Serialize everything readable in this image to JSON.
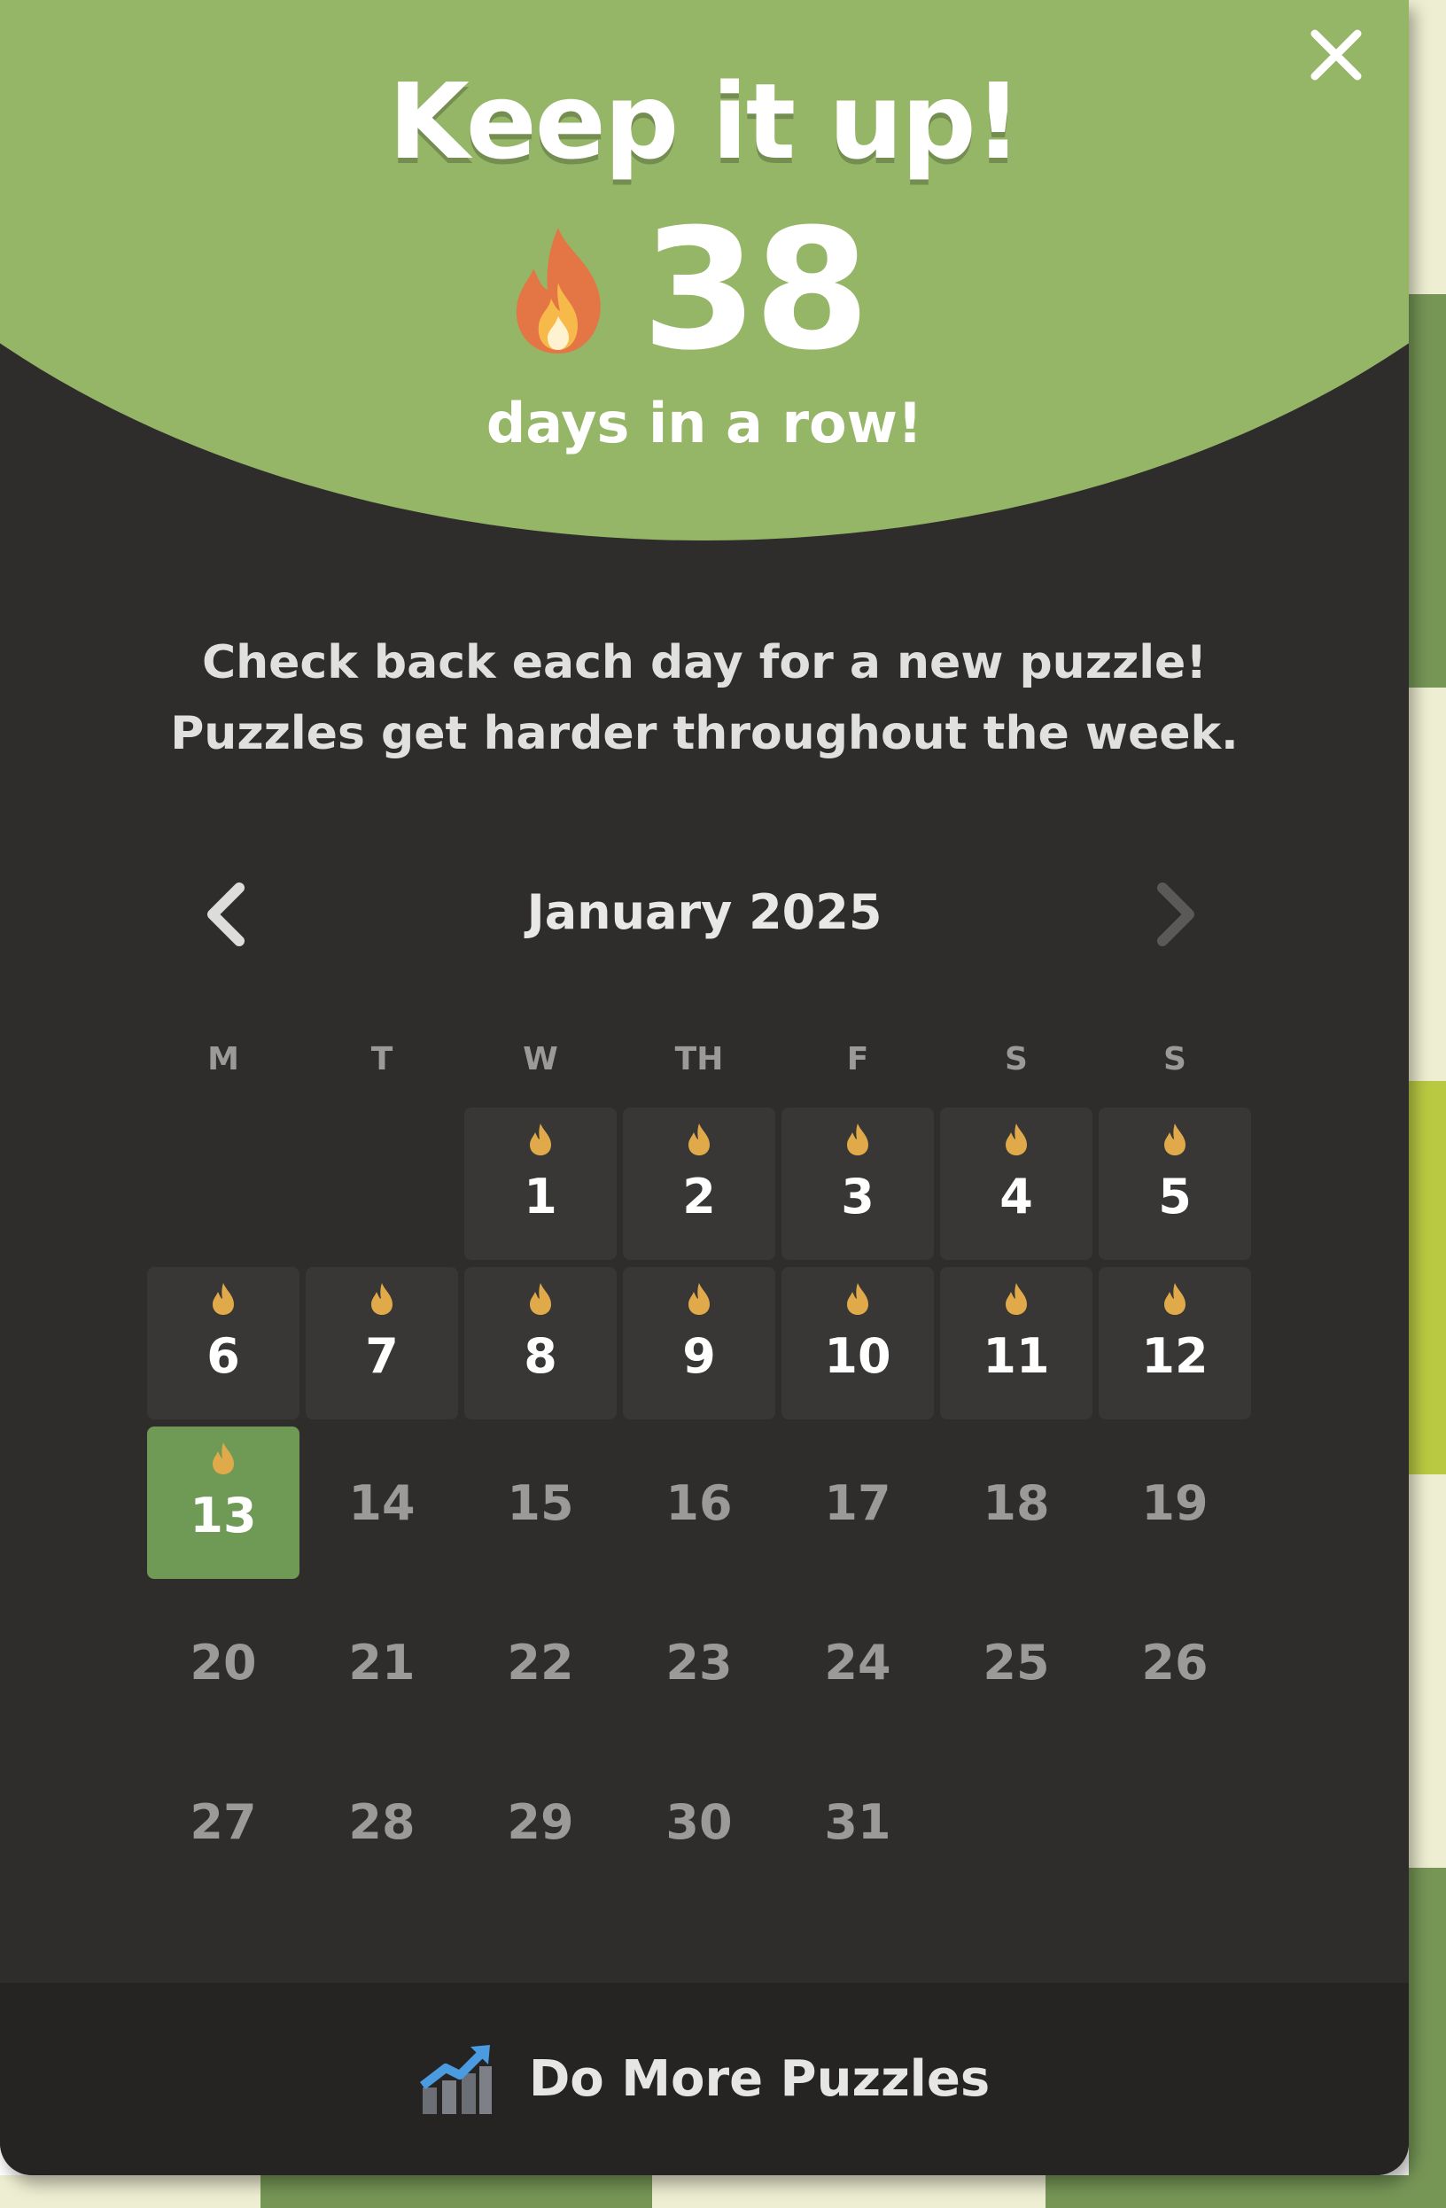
{
  "modal": {
    "title": "Keep it up!",
    "streak_count": "38",
    "streak_label": "days in a row!",
    "subtitle_line1": "Check back each day for a new puzzle!",
    "subtitle_line2": "Puzzles get harder throughout the week.",
    "close_icon": "close-icon"
  },
  "calendar": {
    "month_label": "January 2025",
    "prev_icon": "chevron-left-icon",
    "next_icon": "chevron-right-icon",
    "weekdays": [
      "M",
      "T",
      "W",
      "TH",
      "F",
      "S",
      "S"
    ],
    "days": [
      {
        "day": "1",
        "status": "completed"
      },
      {
        "day": "2",
        "status": "completed"
      },
      {
        "day": "3",
        "status": "completed"
      },
      {
        "day": "4",
        "status": "completed"
      },
      {
        "day": "5",
        "status": "completed"
      },
      {
        "day": "6",
        "status": "completed"
      },
      {
        "day": "7",
        "status": "completed"
      },
      {
        "day": "8",
        "status": "completed"
      },
      {
        "day": "9",
        "status": "completed"
      },
      {
        "day": "10",
        "status": "completed"
      },
      {
        "day": "11",
        "status": "completed"
      },
      {
        "day": "12",
        "status": "completed"
      },
      {
        "day": "13",
        "status": "today"
      },
      {
        "day": "14",
        "status": "future"
      },
      {
        "day": "15",
        "status": "future"
      },
      {
        "day": "16",
        "status": "future"
      },
      {
        "day": "17",
        "status": "future"
      },
      {
        "day": "18",
        "status": "future"
      },
      {
        "day": "19",
        "status": "future"
      },
      {
        "day": "20",
        "status": "future"
      },
      {
        "day": "21",
        "status": "future"
      },
      {
        "day": "22",
        "status": "future"
      },
      {
        "day": "23",
        "status": "future"
      },
      {
        "day": "24",
        "status": "future"
      },
      {
        "day": "25",
        "status": "future"
      },
      {
        "day": "26",
        "status": "future"
      },
      {
        "day": "27",
        "status": "future"
      },
      {
        "day": "28",
        "status": "future"
      },
      {
        "day": "29",
        "status": "future"
      },
      {
        "day": "30",
        "status": "future"
      },
      {
        "day": "31",
        "status": "future"
      }
    ]
  },
  "footer": {
    "label": "Do More Puzzles",
    "icon": "trending-chart-icon"
  },
  "colors": {
    "hero_green": "#95b567",
    "panel_dark": "#2e2d2b",
    "completed_cell": "#383735",
    "today_cell": "#6e9a55",
    "flame_gold": "#e0a94a",
    "footer_bg": "#252422"
  }
}
